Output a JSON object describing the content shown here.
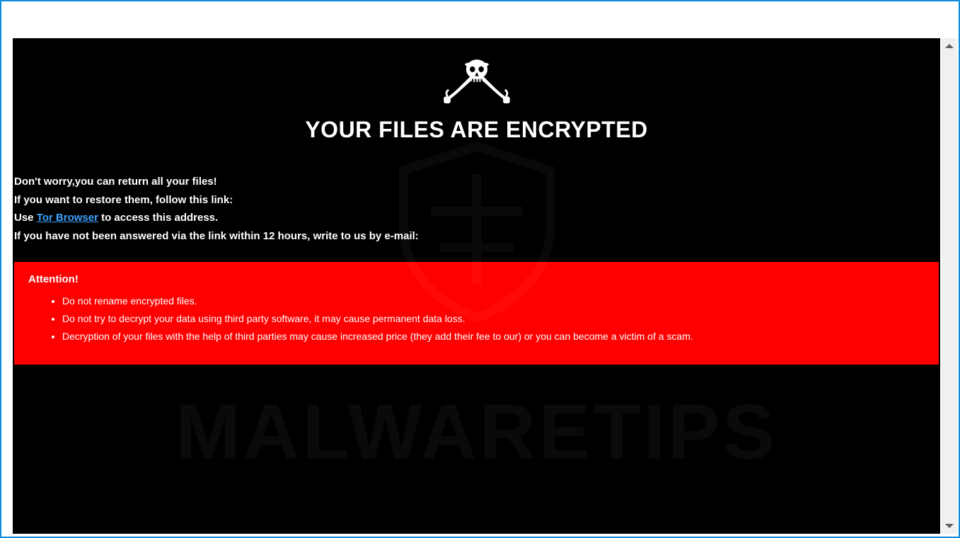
{
  "title": "YOUR FILES ARE ENCRYPTED",
  "body": {
    "line1": "Don't worry,you can return all your files!",
    "line2": "If you want to restore them, follow this link:",
    "line3_prefix": "Use ",
    "line3_link": "Tor Browser",
    "line3_suffix": " to access this address.",
    "line4": "If you have not been answered via the link within 12 hours, write to us by e-mail:"
  },
  "attention": {
    "heading": "Attention!",
    "items": [
      "Do not rename encrypted files.",
      "Do not try to decrypt your data using third party software, it may cause permanent data loss.",
      "Decryption of your files with the help of third parties may cause increased price (they add their fee to our) or you can become a victim of a scam."
    ]
  },
  "watermark_text": "MALWARETIPS"
}
